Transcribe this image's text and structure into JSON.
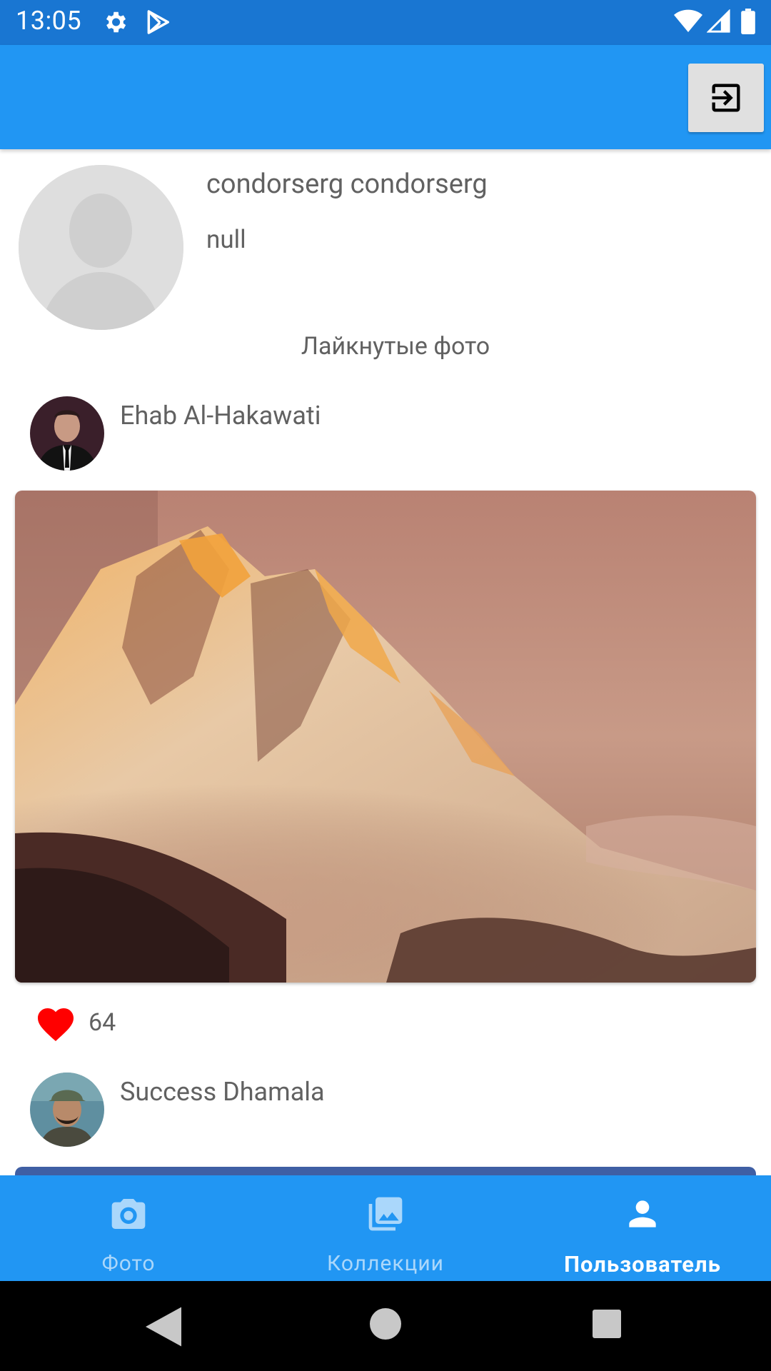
{
  "status_bar": {
    "time": "13:05",
    "icons": [
      "gear-icon",
      "play-store-icon",
      "wifi-icon",
      "signal-icon",
      "battery-icon"
    ]
  },
  "app_bar": {
    "logout_icon": "logout-icon"
  },
  "profile": {
    "name": "condorserg condorserg",
    "bio": "null",
    "avatar": "avatar-placeholder"
  },
  "liked_section": {
    "title": "Лайкнутые фото"
  },
  "liked_photos": [
    {
      "author": "Ehab Al-Hakawati",
      "likes": "64",
      "image": "mountain-sunset-photo"
    },
    {
      "author": "Success Dhamala",
      "image": "blue-photo"
    }
  ],
  "bottom_nav": {
    "items": [
      {
        "label": "Фото",
        "icon": "camera-icon",
        "active": false
      },
      {
        "label": "Коллекции",
        "icon": "collections-icon",
        "active": false
      },
      {
        "label": "Пользователь",
        "icon": "person-icon",
        "active": true
      }
    ]
  },
  "colors": {
    "status_bar": "#1976d2",
    "primary": "#2196f3",
    "text": "#616161",
    "heart": "#ff0000"
  }
}
